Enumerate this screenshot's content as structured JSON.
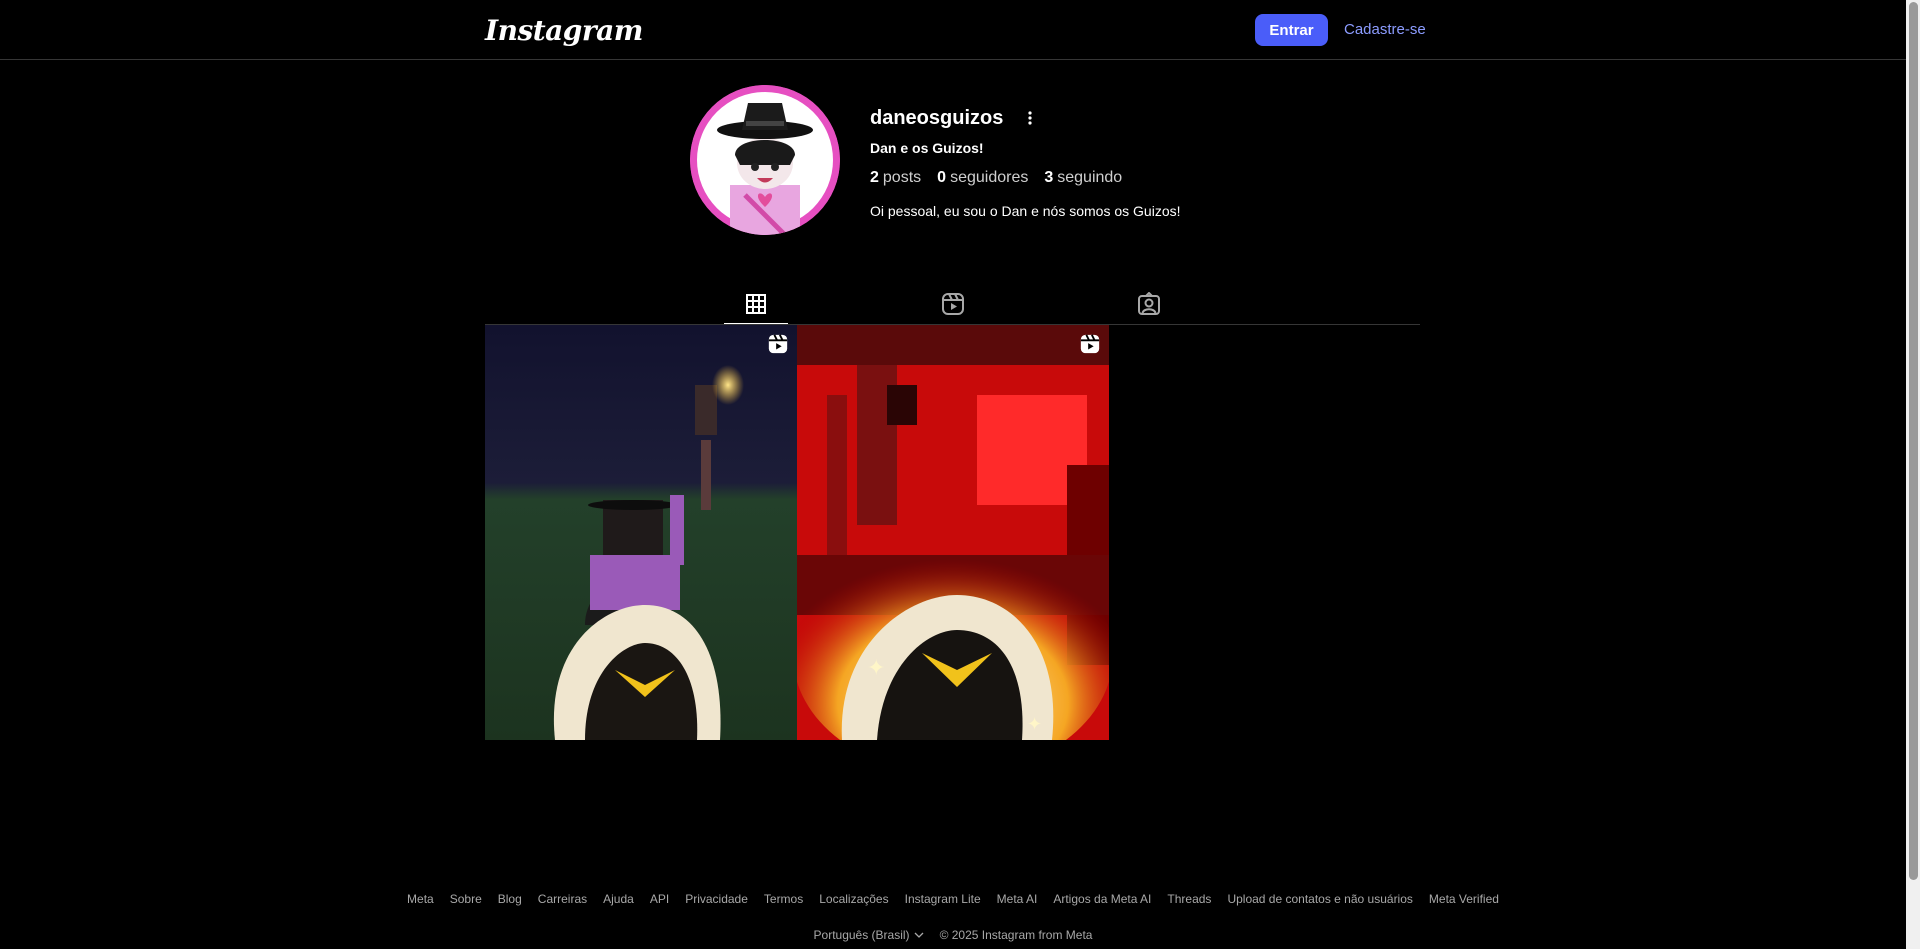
{
  "header": {
    "logo": "Instagram",
    "login_label": "Entrar",
    "signup_label": "Cadastre-se"
  },
  "profile": {
    "username": "daneosguizos",
    "full_name": "Dan e os Guizos!",
    "posts_count": "2",
    "posts_label": "posts",
    "followers_count": "0",
    "followers_label": "seguidores",
    "following_count": "3",
    "following_label": "seguindo",
    "bio": "Oi pessoal, eu sou o Dan e nós somos os Guizos!"
  },
  "tabs": [
    {
      "name": "posts",
      "icon": "grid-icon",
      "active": true
    },
    {
      "name": "reels",
      "icon": "reels-icon",
      "active": false
    },
    {
      "name": "tagged",
      "icon": "tagged-user-icon",
      "active": false
    }
  ],
  "posts": [
    {
      "type": "reel",
      "icon": "reel-badge-icon"
    },
    {
      "type": "reel",
      "icon": "reel-badge-icon"
    }
  ],
  "footer": {
    "links": [
      "Meta",
      "Sobre",
      "Blog",
      "Carreiras",
      "Ajuda",
      "API",
      "Privacidade",
      "Termos",
      "Localizações",
      "Instagram Lite",
      "Meta AI",
      "Artigos da Meta AI",
      "Threads",
      "Upload de contatos e não usuários",
      "Meta Verified"
    ],
    "language": "Português (Brasil)",
    "copyright": "© 2025 Instagram from Meta"
  },
  "colors": {
    "background": "#000000",
    "primary_button": "#4a5df9",
    "link": "#8c9cff",
    "avatar_ring": "#e64fc1"
  }
}
